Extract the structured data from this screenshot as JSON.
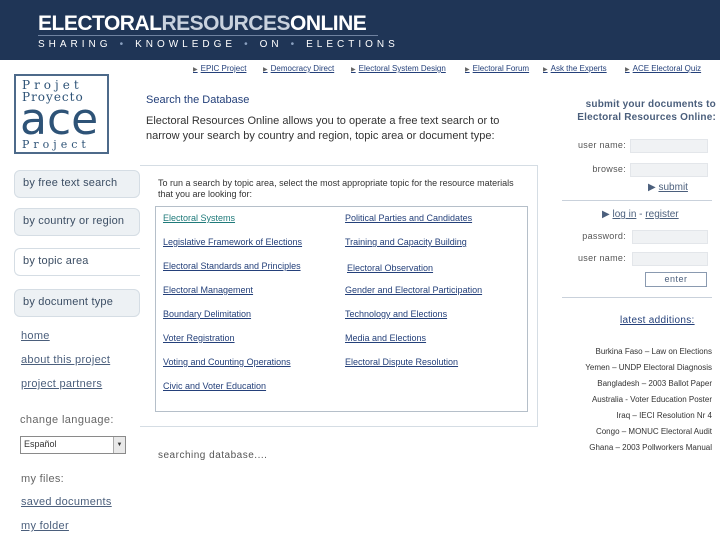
{
  "header": {
    "brand_part1": "ELECTORAL",
    "brand_part2": "RESOURCES",
    "brand_part3": "ONLINE",
    "tagline_words": [
      "SHARING",
      "KNOWLEDGE",
      "ON",
      "ELECTIONS"
    ],
    "tagline_separator": "•"
  },
  "topnav": {
    "arrow": "▶",
    "items": [
      "EPIC Project",
      "Democracy Direct",
      "Electoral System Design",
      "Electoral Forum",
      "Ask the Experts",
      "ACE Electoral Quiz"
    ]
  },
  "logo": {
    "line1": "Projet",
    "line2": "Proyecto",
    "line3": "ace",
    "line4": "Project"
  },
  "search": {
    "title": "Search the Database",
    "description": "Electoral Resources Online allows you to operate a free text search or to narrow your search by country and region, topic area or document type:"
  },
  "left_tabs": [
    "by free text search",
    "by country or region",
    "by topic area",
    "by document type"
  ],
  "left_links": [
    "home",
    "about this project",
    "project partners"
  ],
  "language": {
    "label": "change language:",
    "selected": "Español",
    "dropdown_icon": "▼"
  },
  "myfiles": {
    "label": "my files:",
    "links": [
      "saved documents",
      "my folder"
    ]
  },
  "topics": {
    "instructions": "To run a search by topic area, select the most appropriate topic for the resource materials that you are looking for:",
    "left": [
      "Electoral Systems",
      "Legislative Framework of Elections",
      "Electoral Standards and Principles",
      "Electoral Management",
      "Boundary Delimitation",
      "Voter Registration",
      "Voting and Counting Operations",
      "Civic and Voter Education"
    ],
    "right": [
      "Political Parties and Candidates",
      "Training and Capacity Building",
      "Electoral Observation",
      "Gender and Electoral Participation",
      "Technology and Elections",
      "Media and Elections",
      "Electoral Dispute Resolution"
    ],
    "status": "searching database...."
  },
  "right_panel": {
    "submit_title": "submit your documents to Electoral Resources Online:",
    "user_name_label": "user name:",
    "browse_label": "browse:",
    "submit_link": "submit",
    "login_link": "log in",
    "dash": "-",
    "register_link": "register",
    "password_label": "password:",
    "user_name_label_2": "user name:",
    "enter_button": "enter",
    "arrow": "▶",
    "latest_additions": "latest additions:",
    "additions": [
      "Burkina Faso – Law on Elections",
      "Yemen – UNDP Electoral Diagnosis",
      "Bangladesh – 2003 Ballot Paper",
      "Australia - Voter Education Poster",
      "Iraq – IECI Resolution Nr 4",
      "Congo – MONUC Electoral Audit",
      "Ghana – 2003 Pollworkers Manual"
    ]
  },
  "colors": {
    "header_bg": "#1f3556",
    "link": "#24407a",
    "tab_bg": "#edf1f4"
  }
}
